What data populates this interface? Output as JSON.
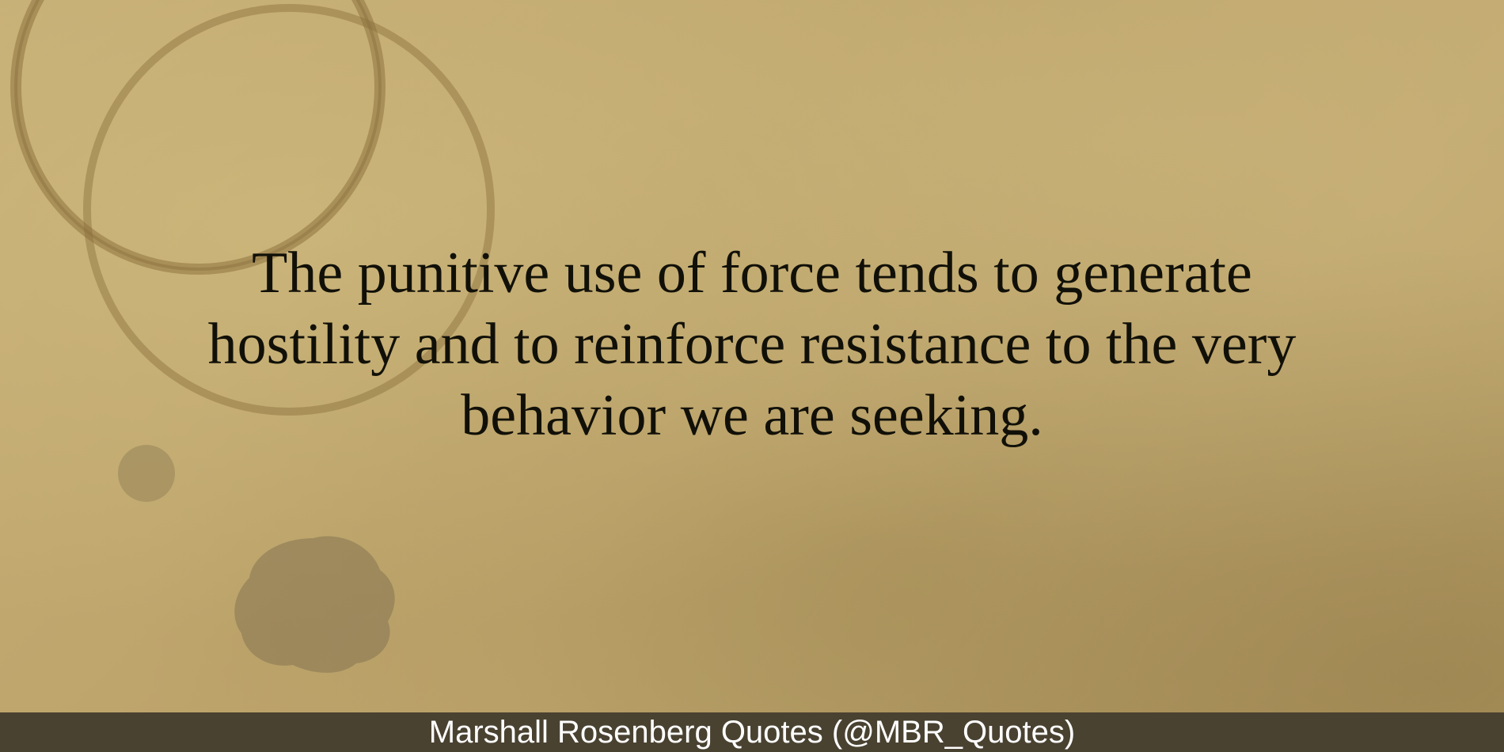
{
  "quote": {
    "text": "The punitive use of force tends to generate hostility and to reinforce resistance to the very behavior we are seeking."
  },
  "footer": {
    "attribution": "Marshall Rosenberg Quotes (@MBR_Quotes)"
  },
  "colors": {
    "paper": "#bfa76e",
    "text": "#111008",
    "footer_bar": "#4a4231",
    "footer_text": "#ffffff"
  }
}
